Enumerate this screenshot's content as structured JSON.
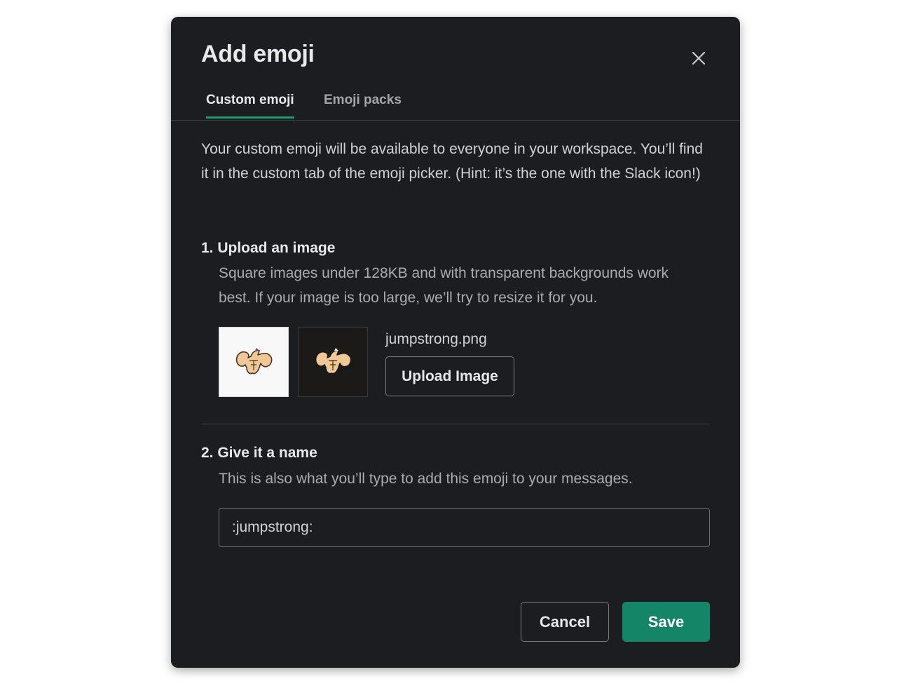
{
  "modal": {
    "title": "Add emoji",
    "close_icon": "close-icon"
  },
  "tabs": [
    {
      "label": "Custom emoji",
      "active": true
    },
    {
      "label": "Emoji packs",
      "active": false
    }
  ],
  "intro_text": "Your custom emoji will be available to everyone in your workspace. You’ll find it in the custom tab of the emoji picker. (Hint: it’s the one with the Slack icon!)",
  "upload_section": {
    "heading": "1. Upload an image",
    "description": "Square images under 128KB and with transparent backgrounds work best. If your image is too large, we’ll try to resize it for you.",
    "filename": "jumpstrong.png",
    "upload_button_label": "Upload Image",
    "preview_icon": "flexing-muscles-emoji"
  },
  "name_section": {
    "heading": "2. Give it a name",
    "description": "This is also what you’ll type to add this emoji to your messages.",
    "input_value": ":jumpstrong:"
  },
  "footer": {
    "cancel_label": "Cancel",
    "save_label": "Save"
  },
  "colors": {
    "modal_background": "#1b1d21",
    "accent": "#1d9a6c",
    "save_button": "#148567"
  }
}
